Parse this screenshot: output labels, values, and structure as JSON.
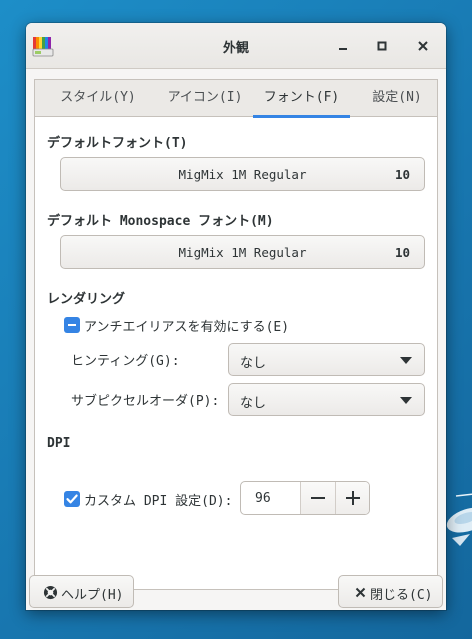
{
  "window": {
    "title": "外観"
  },
  "tabs": [
    {
      "label": "スタイル(Y)"
    },
    {
      "label": "アイコン(I)"
    },
    {
      "label": "フォント(F)"
    },
    {
      "label": "設定(N)"
    }
  ],
  "default_font": {
    "label": "デフォルトフォント(T)",
    "name": "MigMix 1M Regular",
    "size": "10"
  },
  "mono_font": {
    "label": "デフォルト Monospace フォント(M)",
    "name": "MigMix 1M Regular",
    "size": "10"
  },
  "rendering": {
    "label": "レンダリング",
    "antialias_label": "アンチエイリアスを有効にする(E)",
    "antialias_state": "mixed",
    "hinting_label": "ヒンティング(G):",
    "hinting_value": "なし",
    "subpixel_label": "サブピクセルオーダ(P):",
    "subpixel_value": "なし"
  },
  "dpi": {
    "label": "DPI",
    "custom_label": "カスタム DPI 設定(D):",
    "custom_checked": true,
    "value": "96"
  },
  "buttons": {
    "help": "ヘルプ(H)",
    "close": "閉じる(C)"
  },
  "colors": {
    "accent": "#3584e4",
    "desktop": "#1a80bd"
  },
  "icons": {
    "app": "appearance-icon",
    "minimize": "minimize-icon",
    "maximize": "maximize-icon",
    "close": "close-icon",
    "help": "help-lifebuoy-icon",
    "dialog_close": "x-icon"
  }
}
